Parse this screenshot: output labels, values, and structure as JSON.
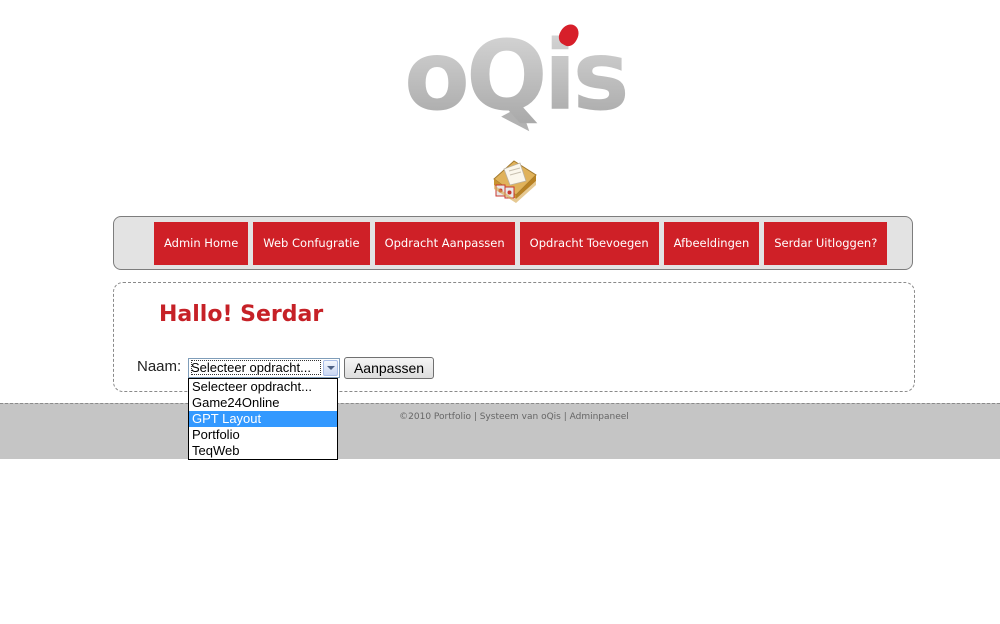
{
  "logo": {
    "text": "oQis",
    "accent_color": "#d71f2a"
  },
  "icons": {
    "mail": "envelope-icon"
  },
  "nav": {
    "items": [
      {
        "label": "Admin Home"
      },
      {
        "label": "Web Confugratie"
      },
      {
        "label": "Opdracht Aanpassen"
      },
      {
        "label": "Opdracht Toevoegen"
      },
      {
        "label": "Afbeeldingen"
      },
      {
        "label": "Serdar Uitloggen?"
      }
    ],
    "item_color": "#cf2027"
  },
  "main": {
    "greeting": "Hallo! Serdar",
    "greeting_color": "#c62127",
    "form": {
      "label": "Naam:",
      "select_value": "Selecteer opdracht...",
      "submit_label": "Aanpassen"
    }
  },
  "dropdown": {
    "options": [
      {
        "label": "Selecteer opdracht..."
      },
      {
        "label": "Game24Online"
      },
      {
        "label": "GPT Layout",
        "highlighted": true
      },
      {
        "label": "Portfolio"
      },
      {
        "label": "TeqWeb"
      }
    ],
    "highlight_color": "#3399ff"
  },
  "footer": {
    "text": "©2010 Portfolio | Systeem van oQis | Adminpaneel"
  }
}
